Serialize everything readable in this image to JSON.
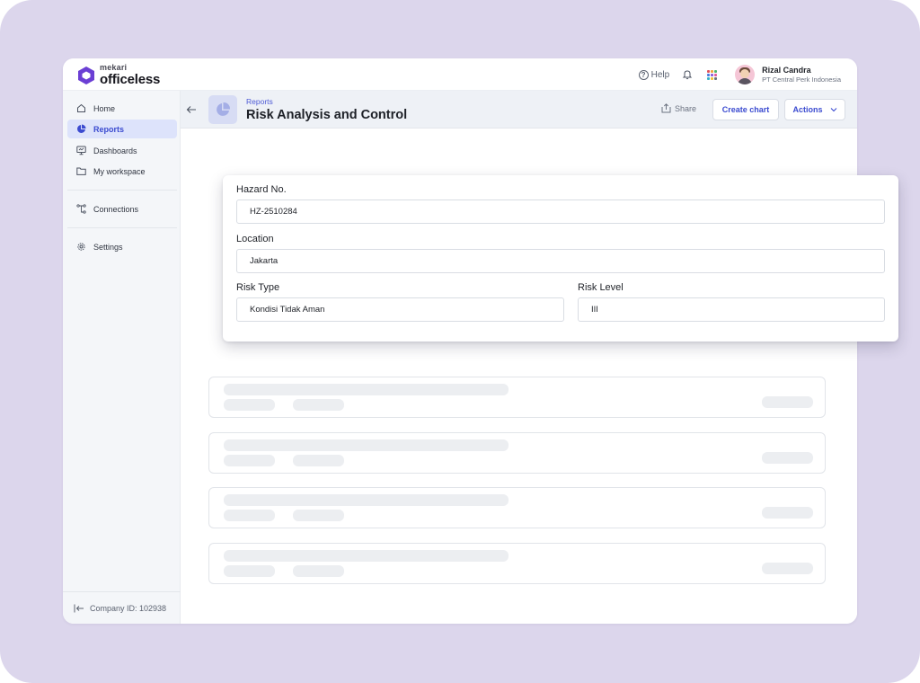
{
  "brand": {
    "small": "mekari",
    "big": "officeless",
    "colors": {
      "hex": "#6b3fd4",
      "accent": "#3b4bd0",
      "backdrop": "#dcd6ec"
    }
  },
  "topbar": {
    "help_label": "Help",
    "icons": [
      "help-icon",
      "bell-icon",
      "apps-grid-icon"
    ],
    "user": {
      "name": "Rizal Candra",
      "company": "PT Central Perk Indonesia"
    }
  },
  "sidebar": {
    "items": [
      {
        "label": "Home",
        "icon": "home-icon",
        "active": false
      },
      {
        "label": "Reports",
        "icon": "pie-chart-icon",
        "active": true
      },
      {
        "label": "Dashboards",
        "icon": "dashboard-icon",
        "active": false
      },
      {
        "label": "My workspace",
        "icon": "folder-icon",
        "active": false
      },
      {
        "label": "Connections",
        "icon": "connections-icon",
        "active": false
      },
      {
        "label": "Settings",
        "icon": "gear-icon",
        "active": false
      }
    ],
    "footer": "Company ID: 102938"
  },
  "header": {
    "breadcrumb": "Reports",
    "title": "Risk Analysis and Control",
    "share_label": "Share",
    "create_chart_label": "Create chart",
    "actions_label": "Actions"
  },
  "form": {
    "hazard": {
      "label": "Hazard No.",
      "value": "HZ-2510284"
    },
    "location": {
      "label": "Location",
      "value": "Jakarta"
    },
    "risk_type": {
      "label": "Risk Type",
      "value": "Kondisi Tidak Aman"
    },
    "risk_level": {
      "label": "Risk Level",
      "value": "III"
    }
  }
}
